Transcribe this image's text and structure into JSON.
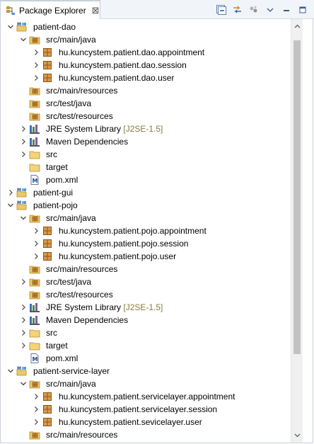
{
  "view": {
    "tab_title": "Package Explorer",
    "tab_close": "⊠",
    "toolbar": [
      "collapse-all-icon",
      "link-with-editor-icon",
      "focus-icon",
      "view-menu-icon",
      "minimize-icon",
      "maximize-icon"
    ]
  },
  "tree": [
    {
      "level": 0,
      "expanded": true,
      "icon": "maven-project",
      "label": "patient-dao"
    },
    {
      "level": 1,
      "expanded": true,
      "icon": "source-folder",
      "label": "src/main/java"
    },
    {
      "level": 2,
      "expanded": false,
      "icon": "package",
      "label": "hu.kuncystem.patient.dao.appointment"
    },
    {
      "level": 2,
      "expanded": false,
      "icon": "package",
      "label": "hu.kuncystem.patient.dao.session"
    },
    {
      "level": 2,
      "expanded": false,
      "icon": "package",
      "label": "hu.kuncystem.patient.dao.user"
    },
    {
      "level": 1,
      "expanded": null,
      "icon": "source-folder",
      "label": "src/main/resources"
    },
    {
      "level": 1,
      "expanded": null,
      "icon": "source-folder",
      "label": "src/test/java"
    },
    {
      "level": 1,
      "expanded": null,
      "icon": "source-folder",
      "label": "src/test/resources"
    },
    {
      "level": 1,
      "expanded": false,
      "icon": "library",
      "label": "JRE System Library",
      "decoration": "[J2SE-1.5]"
    },
    {
      "level": 1,
      "expanded": false,
      "icon": "library",
      "label": "Maven Dependencies"
    },
    {
      "level": 1,
      "expanded": false,
      "icon": "folder",
      "label": "src"
    },
    {
      "level": 1,
      "expanded": null,
      "icon": "folder",
      "label": "target"
    },
    {
      "level": 1,
      "expanded": null,
      "icon": "maven-file",
      "label": "pom.xml"
    },
    {
      "level": 0,
      "expanded": false,
      "icon": "maven-project",
      "label": "patient-gui"
    },
    {
      "level": 0,
      "expanded": true,
      "icon": "maven-project",
      "label": "patient-pojo"
    },
    {
      "level": 1,
      "expanded": true,
      "icon": "source-folder",
      "label": "src/main/java"
    },
    {
      "level": 2,
      "expanded": false,
      "icon": "package",
      "label": "hu.kuncystem.patient.pojo.appointment"
    },
    {
      "level": 2,
      "expanded": false,
      "icon": "package",
      "label": "hu.kuncystem.patient.pojo.session"
    },
    {
      "level": 2,
      "expanded": false,
      "icon": "package",
      "label": "hu.kuncystem.patient.pojo.user"
    },
    {
      "level": 1,
      "expanded": null,
      "icon": "source-folder",
      "label": "src/main/resources"
    },
    {
      "level": 1,
      "expanded": false,
      "icon": "source-folder",
      "label": "src/test/java"
    },
    {
      "level": 1,
      "expanded": null,
      "icon": "source-folder",
      "label": "src/test/resources"
    },
    {
      "level": 1,
      "expanded": false,
      "icon": "library",
      "label": "JRE System Library",
      "decoration": "[J2SE-1.5]"
    },
    {
      "level": 1,
      "expanded": false,
      "icon": "library",
      "label": "Maven Dependencies"
    },
    {
      "level": 1,
      "expanded": false,
      "icon": "folder",
      "label": "src"
    },
    {
      "level": 1,
      "expanded": false,
      "icon": "folder",
      "label": "target"
    },
    {
      "level": 1,
      "expanded": null,
      "icon": "maven-file",
      "label": "pom.xml"
    },
    {
      "level": 0,
      "expanded": true,
      "icon": "maven-project",
      "label": "patient-service-layer"
    },
    {
      "level": 1,
      "expanded": true,
      "icon": "source-folder",
      "label": "src/main/java"
    },
    {
      "level": 2,
      "expanded": false,
      "icon": "package",
      "label": "hu.kuncystem.patient.servicelayer.appointment"
    },
    {
      "level": 2,
      "expanded": false,
      "icon": "package",
      "label": "hu.kuncystem.patient.servicelayer.session"
    },
    {
      "level": 2,
      "expanded": false,
      "icon": "package",
      "label": "hu.kuncystem.patient.sevicelayer.user"
    },
    {
      "level": 1,
      "expanded": null,
      "icon": "source-folder",
      "label": "src/main/resources"
    }
  ],
  "colors": {
    "decoration": "#8a7a3a",
    "package": "#b5651d",
    "folder": "#e8c15a",
    "scroll_thumb": "#c2c2c2"
  }
}
